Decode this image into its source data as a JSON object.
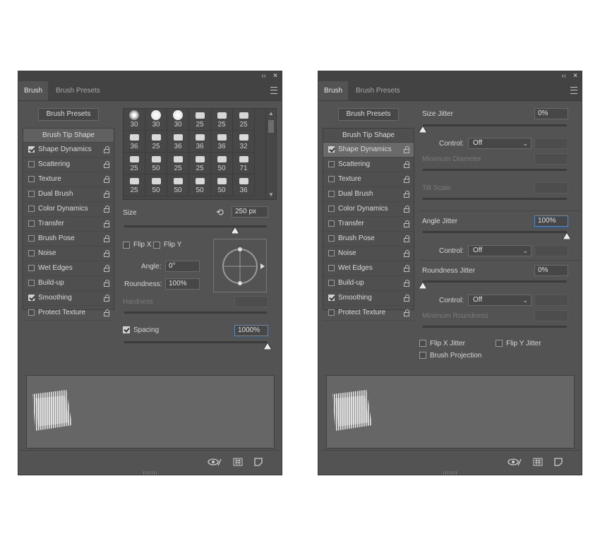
{
  "tabs": {
    "brush": "Brush",
    "presets": "Brush Presets"
  },
  "window": {
    "collapse_glyph": "‹‹",
    "close_glyph": "×"
  },
  "presets_button": "Brush Presets",
  "sidebar": {
    "tip": "Brush Tip Shape",
    "items": [
      {
        "label": "Shape Dynamics",
        "checked": true
      },
      {
        "label": "Scattering",
        "checked": false
      },
      {
        "label": "Texture",
        "checked": false
      },
      {
        "label": "Dual Brush",
        "checked": false
      },
      {
        "label": "Color Dynamics",
        "checked": false
      },
      {
        "label": "Transfer",
        "checked": false
      },
      {
        "label": "Brush Pose",
        "checked": false
      },
      {
        "label": "Noise",
        "checked": false
      },
      {
        "label": "Wet Edges",
        "checked": false
      },
      {
        "label": "Build-up",
        "checked": false
      },
      {
        "label": "Smoothing",
        "checked": true
      },
      {
        "label": "Protect Texture",
        "checked": false
      }
    ]
  },
  "brush_grid": [
    [
      "30",
      "30",
      "30",
      "25",
      "25",
      "25"
    ],
    [
      "36",
      "25",
      "36",
      "36",
      "36",
      "32"
    ],
    [
      "25",
      "50",
      "25",
      "25",
      "50",
      "71"
    ],
    [
      "25",
      "50",
      "50",
      "50",
      "50",
      "36"
    ]
  ],
  "tip_shape": {
    "size_label": "Size",
    "size_value": "250 px",
    "flip_x": "Flip X",
    "flip_y": "Flip Y",
    "angle_label": "Angle:",
    "angle_value": "0°",
    "roundness_label": "Roundness:",
    "roundness_value": "100%",
    "hardness_label": "Hardness",
    "spacing_label": "Spacing",
    "spacing_value": "1000%"
  },
  "shape_dynamics": {
    "size_jitter_label": "Size Jitter",
    "size_jitter_value": "0%",
    "control_label": "Control:",
    "control_value": "Off",
    "min_diameter_label": "Minimum Diameter",
    "tilt_scale_label": "Tilt Scale",
    "angle_jitter_label": "Angle Jitter",
    "angle_jitter_value": "100%",
    "roundness_jitter_label": "Roundness Jitter",
    "roundness_jitter_value": "0%",
    "min_roundness_label": "Minimum Roundness",
    "flip_x_jitter": "Flip X Jitter",
    "flip_y_jitter": "Flip Y Jitter",
    "brush_projection": "Brush Projection"
  },
  "colors": {
    "panel": "#535353",
    "accent_focus": "#4a8edb"
  }
}
